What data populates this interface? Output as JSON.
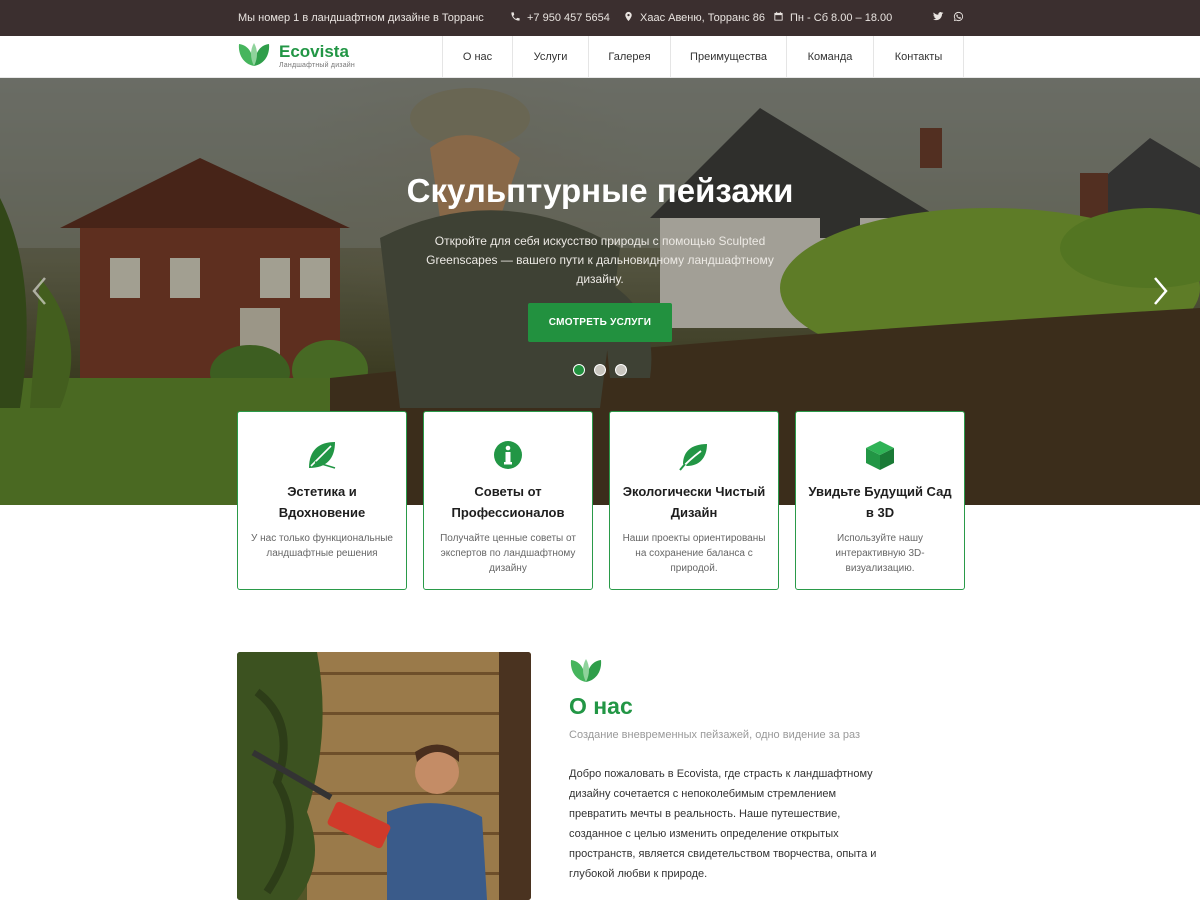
{
  "topbar": {
    "tagline": "Мы номер 1 в ландшафтном дизайне в Торранс",
    "phone": "+7 950 457 5654",
    "address": "Хаас Авеню, Торранс 86",
    "hours": "Пн - Сб 8.00 – 18.00",
    "icons": [
      "phone-icon",
      "location-icon",
      "calendar-icon",
      "twitter-icon",
      "whatsapp-icon"
    ]
  },
  "brand": {
    "name": "Ecovista",
    "subtitle": "Ландшафтный дизайн",
    "color": "#229645"
  },
  "nav": {
    "items": [
      {
        "label": "О нас"
      },
      {
        "label": "Услуги"
      },
      {
        "label": "Галерея"
      },
      {
        "label": "Преимущества"
      },
      {
        "label": "Команда"
      },
      {
        "label": "Контакты"
      }
    ]
  },
  "hero": {
    "title": "Скульптурные пейзажи",
    "text": "Откройте для себя искусство природы с помощью Sculpted Greenscapes — вашего пути к дальновидному ландшафтному дизайну.",
    "button": "СМОТРЕТЬ УСЛУГИ",
    "slides": 3,
    "active_slide": 1,
    "accent": "#22913f"
  },
  "features": [
    {
      "icon": "leaf-icon",
      "title": "Эстетика и Вдохновение",
      "text": "У нас только функциональные ландшафтные решения"
    },
    {
      "icon": "info-icon",
      "title": "Советы от Профессионалов",
      "text": "Получайте ценные советы от экспертов по ландшафтному дизайну"
    },
    {
      "icon": "eco-leaf-icon",
      "title": "Экологически Чистый Дизайн",
      "text": "Наши проекты ориентированы на сохранение баланса с природой."
    },
    {
      "icon": "cube-icon",
      "title": "Увидьте Будущий Сад в 3D",
      "text": "Используйте нашу интерактивную 3D-визуализацию."
    }
  ],
  "about": {
    "title": "О нас",
    "subtitle": "Создание вневременных пейзажей, одно видение за раз",
    "text": "Добро пожаловать в Ecovista, где страсть к ландшафтному дизайну сочетается с непоколебимым стремлением превратить мечты в реальность. Наше путешествие, созданное с целью изменить определение открытых пространств, является свидетельством творчества, опыта и глубокой любви к природе."
  }
}
